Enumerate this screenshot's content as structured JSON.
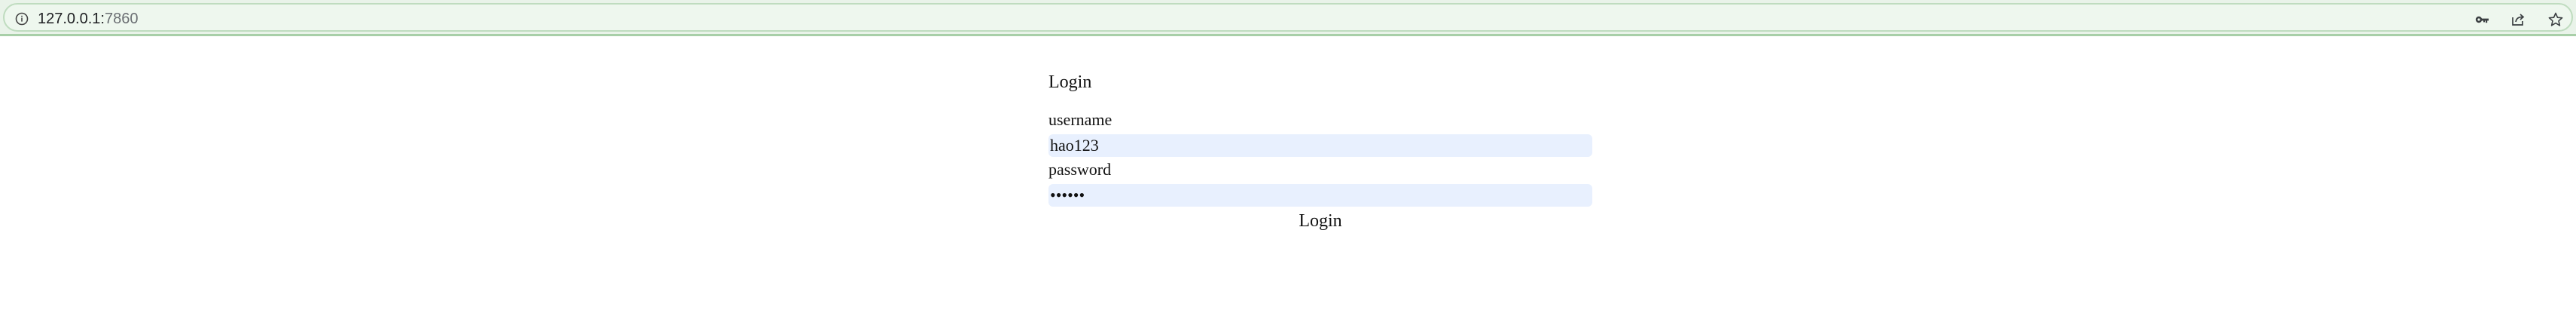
{
  "browser": {
    "url_host": "127.0.0.1:",
    "url_port": "7860",
    "icons": [
      "info-icon",
      "key-icon",
      "share-icon",
      "star-icon"
    ]
  },
  "login": {
    "title": "Login",
    "username_label": "username",
    "username_value": "hao123",
    "password_label": "password",
    "password_value": "••••••",
    "button_label": "Login"
  },
  "colors": {
    "input_background": "#e8f0fe",
    "browser_bar": "#e9f3e9",
    "browser_bar_border": "#a8cfa8"
  }
}
